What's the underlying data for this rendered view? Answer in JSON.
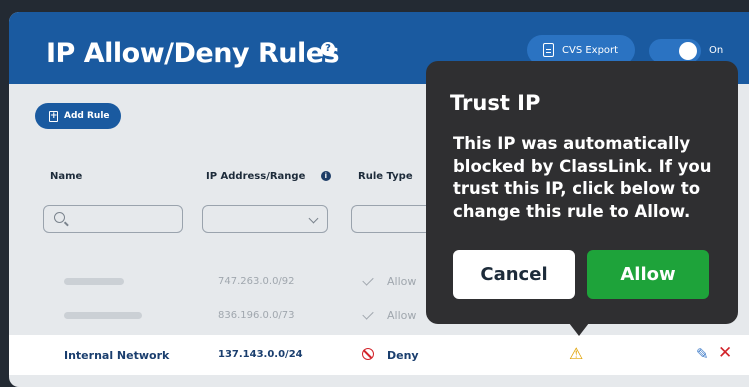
{
  "header": {
    "title": "IP Allow/Deny Rules",
    "help_icon": "?",
    "export_label": "CVS Export",
    "toggle_label": "On"
  },
  "toolbar": {
    "add_rule_label": "Add Rule",
    "add_icon": "+"
  },
  "table": {
    "columns": [
      "Name",
      "IP Address/Range",
      "Rule Type"
    ],
    "info_icon": "i",
    "rows": [
      {
        "ip": "747.263.0.0/92",
        "type": "Allow"
      },
      {
        "ip": "836.196.0.0/73",
        "type": "Allow"
      }
    ],
    "highlighted_row": {
      "name": "Internal Network",
      "ip": "137.143.0.0/24",
      "type": "Deny"
    }
  },
  "popover": {
    "title": "Trust IP",
    "body": "This IP was  automatically\nblocked by ClassLink. If you\ntrust this IP, click below to\nchange this rule to Allow.",
    "cancel_label": "Cancel",
    "allow_label": "Allow"
  },
  "icons": {
    "warning": "⚠",
    "edit": "✎",
    "delete": "✕"
  },
  "colors": {
    "header_bg": "#1a5aa0",
    "allow_green": "#1ea33a",
    "deny_red": "#d2232a",
    "warning_yellow": "#e0a100"
  }
}
